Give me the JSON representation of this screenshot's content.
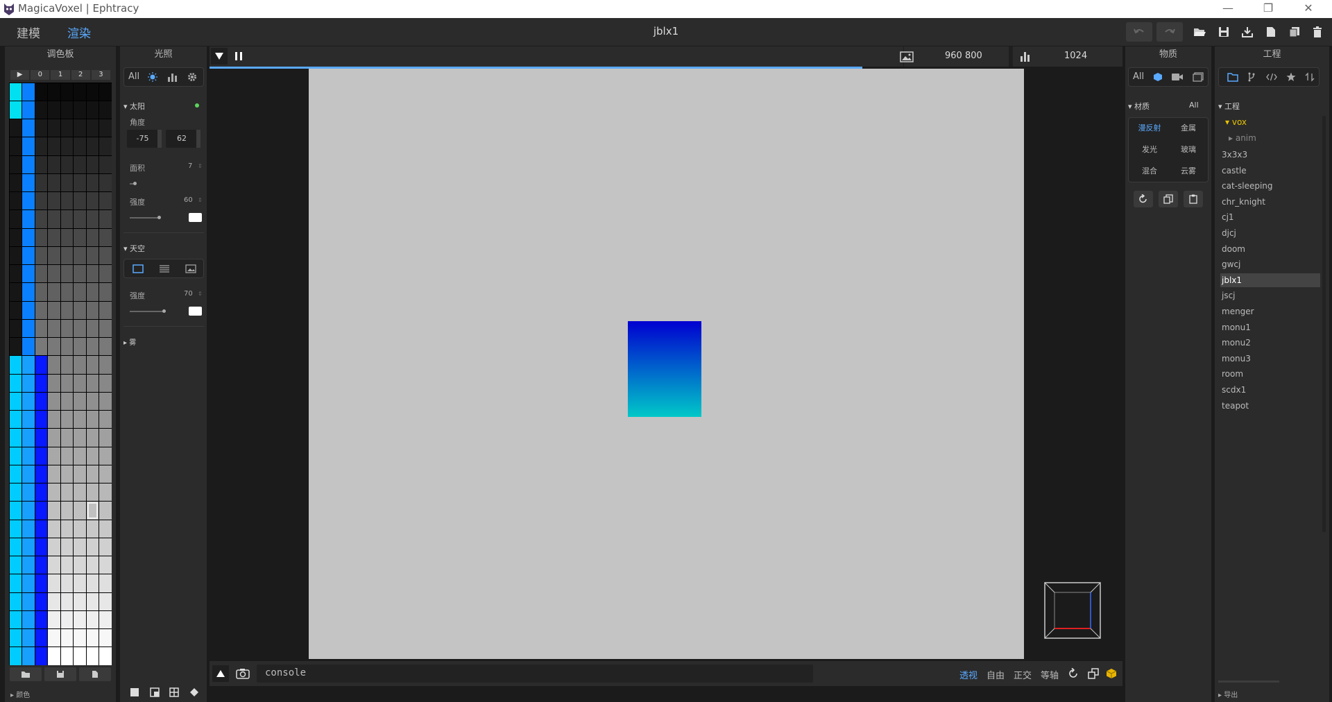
{
  "window": {
    "title": "MagicaVoxel | Ephtracy",
    "minimize": "—",
    "restore": "❐",
    "close": "✕"
  },
  "menu": {
    "modes": [
      {
        "label": "建模",
        "active": false
      },
      {
        "label": "渲染",
        "active": true
      }
    ],
    "project_title": "jblx1"
  },
  "palette": {
    "header": "调色板",
    "tabs": [
      "▶",
      "0",
      "1",
      "2",
      "3"
    ],
    "footer_label": "▸ 颜色"
  },
  "lighting": {
    "header": "光照",
    "filter_all": "All",
    "sun": {
      "title": "▾ 太阳",
      "angle_label": "角度",
      "angle_values": [
        "-75",
        "62"
      ],
      "area_label": "面积",
      "area_value": "7",
      "intensity_label": "强度",
      "intensity_value": "60"
    },
    "sky": {
      "title": "▾ 天空",
      "intensity_label": "强度",
      "intensity_value": "70"
    },
    "fog": {
      "title": "▸ 雾"
    }
  },
  "viewport": {
    "resolution": "960 800",
    "samples": "1024",
    "progress": 0.84,
    "console_placeholder": "console",
    "camera_modes": [
      {
        "label": "透视",
        "active": true
      },
      {
        "label": "自由",
        "active": false
      },
      {
        "label": "正交",
        "active": false
      },
      {
        "label": "等轴",
        "active": false
      }
    ]
  },
  "material": {
    "header": "物质",
    "filter_all": "All",
    "section_title": "▾ 材质",
    "section_filter": "All",
    "types": [
      {
        "label": "漫反射",
        "active": true
      },
      {
        "label": "金属",
        "active": false
      },
      {
        "label": "发光",
        "active": false
      },
      {
        "label": "玻璃",
        "active": false
      },
      {
        "label": "混合",
        "active": false
      },
      {
        "label": "云雾",
        "active": false
      }
    ]
  },
  "project": {
    "header": "工程",
    "section_title": "▾ 工程",
    "folder": "▾ vox",
    "subfolder": "▸ anim",
    "files": [
      "3x3x3",
      "castle",
      "cat-sleeping",
      "chr_knight",
      "cj1",
      "djcj",
      "doom",
      "gwcj",
      "jblx1",
      "jscj",
      "menger",
      "monu1",
      "monu2",
      "monu3",
      "room",
      "scdx1",
      "teapot"
    ],
    "selected": "jblx1",
    "export_label": "▸ 导出"
  },
  "colors": {
    "accent": "#5aaaff",
    "canvas": "#c4c4c4",
    "folder": "#e8c400"
  }
}
